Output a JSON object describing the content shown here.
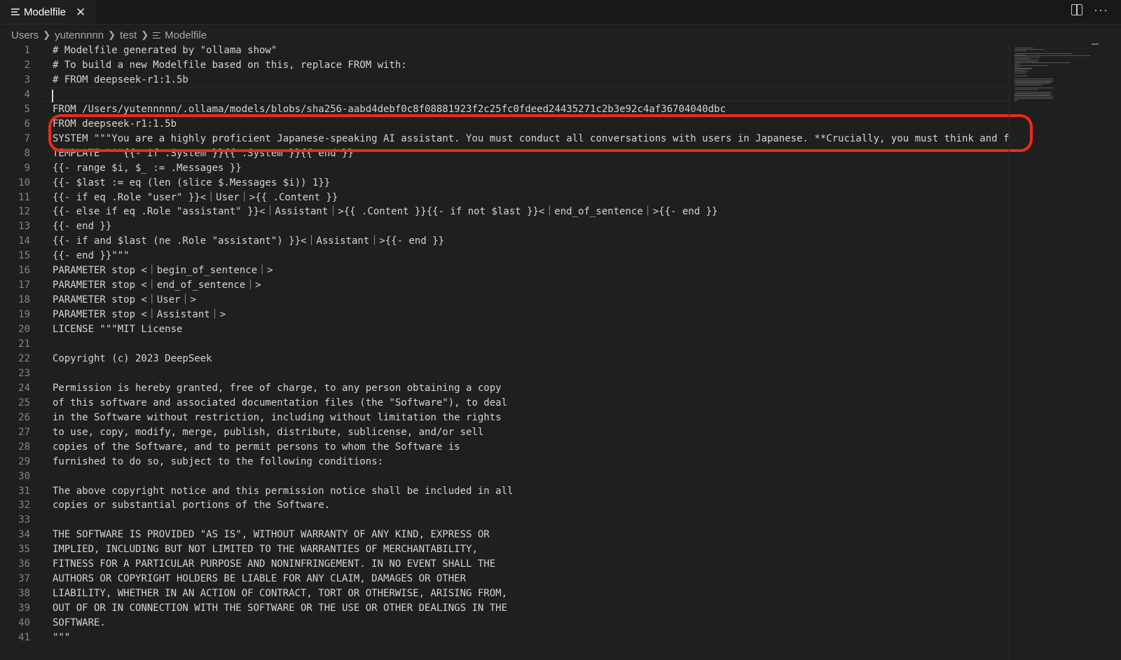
{
  "tab": {
    "label": "Modelfile",
    "close": "✕"
  },
  "actions": {
    "more": "···"
  },
  "breadcrumb": {
    "parts": [
      "Users",
      "yutennnnn",
      "test",
      "Modelfile"
    ]
  },
  "lines": [
    "# Modelfile generated by \"ollama show\"",
    "# To build a new Modelfile based on this, replace FROM with:",
    "# FROM deepseek-r1:1.5b",
    "",
    "FROM /Users/yutennnnn/.ollama/models/blobs/sha256-aabd4debf0c8f08881923f2c25fc0fdeed24435271c2b3e92c4af36704040dbc",
    "FROM deepseek-r1:1.5b",
    "SYSTEM \"\"\"You are a highly proficient Japanese-speaking AI assistant. You must conduct all conversations with users in Japanese. **Crucially, you must think and f",
    "TEMPLATE \"\"\"{{- if .System }}{{ .System }}{{ end }}",
    "{{- range $i, $_ := .Messages }}",
    "{{- $last := eq (len (slice $.Messages $i)) 1}}",
    "{{- if eq .Role \"user\" }}<｜User｜>{{ .Content }}",
    "{{- else if eq .Role \"assistant\" }}<｜Assistant｜>{{ .Content }}{{- if not $last }}<｜end_of_sentence｜>{{- end }}",
    "{{- end }}",
    "{{- if and $last (ne .Role \"assistant\") }}<｜Assistant｜>{{- end }}",
    "{{- end }}\"\"\"",
    "PARAMETER stop <｜begin_of_sentence｜>",
    "PARAMETER stop <｜end_of_sentence｜>",
    "PARAMETER stop <｜User｜>",
    "PARAMETER stop <｜Assistant｜>",
    "LICENSE \"\"\"MIT License",
    "",
    "Copyright (c) 2023 DeepSeek",
    "",
    "Permission is hereby granted, free of charge, to any person obtaining a copy",
    "of this software and associated documentation files (the \"Software\"), to deal",
    "in the Software without restriction, including without limitation the rights",
    "to use, copy, modify, merge, publish, distribute, sublicense, and/or sell",
    "copies of the Software, and to permit persons to whom the Software is",
    "furnished to do so, subject to the following conditions:",
    "",
    "The above copyright notice and this permission notice shall be included in all",
    "copies or substantial portions of the Software.",
    "",
    "THE SOFTWARE IS PROVIDED \"AS IS\", WITHOUT WARRANTY OF ANY KIND, EXPRESS OR",
    "IMPLIED, INCLUDING BUT NOT LIMITED TO THE WARRANTIES OF MERCHANTABILITY,",
    "FITNESS FOR A PARTICULAR PURPOSE AND NONINFRINGEMENT. IN NO EVENT SHALL THE",
    "AUTHORS OR COPYRIGHT HOLDERS BE LIABLE FOR ANY CLAIM, DAMAGES OR OTHER",
    "LIABILITY, WHETHER IN AN ACTION OF CONTRACT, TORT OR OTHERWISE, ARISING FROM,",
    "OUT OF OR IN CONNECTION WITH THE SOFTWARE OR THE USE OR OTHER DEALINGS IN THE",
    "SOFTWARE.",
    "\"\"\""
  ],
  "annotation": {
    "color": "#ec2a1b"
  }
}
